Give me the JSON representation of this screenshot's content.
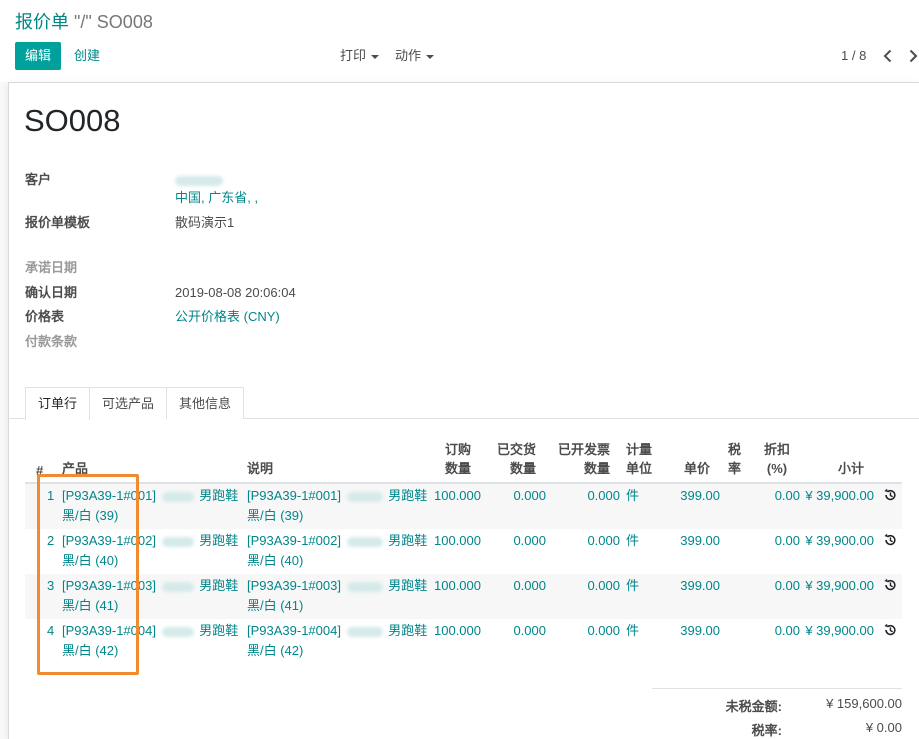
{
  "breadcrumb": {
    "parent": "报价单",
    "current": "\"/\" SO008"
  },
  "toolbar": {
    "edit_label": "编辑",
    "create_label": "创建",
    "print_label": "打印",
    "action_label": "动作",
    "pager": "1 / 8"
  },
  "record": {
    "name": "SO008"
  },
  "fields": {
    "customer_label": "客户",
    "customer_address": "中国, 广东省, ,",
    "template_label": "报价单模板",
    "template_value": "散码演示1",
    "commitment_date_label": "承诺日期",
    "confirm_date_label": "确认日期",
    "confirm_date_value": "2019-08-08 20:06:04",
    "pricelist_label": "价格表",
    "pricelist_value": "公开价格表 (CNY)",
    "payment_terms_label": "付款条款"
  },
  "tabs": [
    {
      "label": "订单行",
      "active": true
    },
    {
      "label": "可选产品",
      "active": false
    },
    {
      "label": "其他信息",
      "active": false
    }
  ],
  "table": {
    "headers": {
      "seq": "#",
      "product": "产品",
      "description": "说明",
      "qty_1": "订购",
      "qty_2": "数量",
      "delivered_1": "已交货",
      "delivered_2": "数量",
      "invoiced_1": "已开发票",
      "invoiced_2": "数量",
      "uom_1": "计量",
      "uom_2": "单位",
      "price": "单价",
      "tax_1": "税",
      "tax_2": "率",
      "discount_1": "折扣",
      "discount_2": "(%)",
      "subtotal": "小计"
    },
    "rows": [
      {
        "seq": "1",
        "product_code": "[P93A39-1#001]",
        "product_suffix": "男跑鞋",
        "variant": "黑/白 (39)",
        "desc_code": "[P93A39-1#001]",
        "desc_suffix": "男跑鞋",
        "desc_variant": "黑/白 (39)",
        "qty": "100.000",
        "delivered": "0.000",
        "invoiced": "0.000",
        "uom": "件",
        "price": "399.00",
        "discount": "0.00",
        "subtotal": "¥ 39,900.00"
      },
      {
        "seq": "2",
        "product_code": "[P93A39-1#002]",
        "product_suffix": "男跑鞋",
        "variant": "黑/白 (40)",
        "desc_code": "[P93A39-1#002]",
        "desc_suffix": "男跑鞋",
        "desc_variant": "黑/白 (40)",
        "qty": "100.000",
        "delivered": "0.000",
        "invoiced": "0.000",
        "uom": "件",
        "price": "399.00",
        "discount": "0.00",
        "subtotal": "¥ 39,900.00"
      },
      {
        "seq": "3",
        "product_code": "[P93A39-1#003]",
        "product_suffix": "男跑鞋",
        "variant": "黑/白 (41)",
        "desc_code": "[P93A39-1#003]",
        "desc_suffix": "男跑鞋",
        "desc_variant": "黑/白 (41)",
        "qty": "100.000",
        "delivered": "0.000",
        "invoiced": "0.000",
        "uom": "件",
        "price": "399.00",
        "discount": "0.00",
        "subtotal": "¥ 39,900.00"
      },
      {
        "seq": "4",
        "product_code": "[P93A39-1#004]",
        "product_suffix": "男跑鞋",
        "variant": "黑/白 (42)",
        "desc_code": "[P93A39-1#004]",
        "desc_suffix": "男跑鞋",
        "desc_variant": "黑/白 (42)",
        "qty": "100.000",
        "delivered": "0.000",
        "invoiced": "0.000",
        "uom": "件",
        "price": "399.00",
        "discount": "0.00",
        "subtotal": "¥ 39,900.00"
      }
    ]
  },
  "totals": {
    "untaxed_label": "未税金额:",
    "untaxed_value": "¥ 159,600.00",
    "tax_label": "税率:",
    "tax_value": "¥ 0.00"
  },
  "icons": {
    "history": "history-icon",
    "prev": "chevron-left-icon",
    "next": "chevron-right-icon"
  },
  "colors": {
    "primary": "#00a09d",
    "link": "#00868b",
    "highlight": "#f28b30"
  }
}
